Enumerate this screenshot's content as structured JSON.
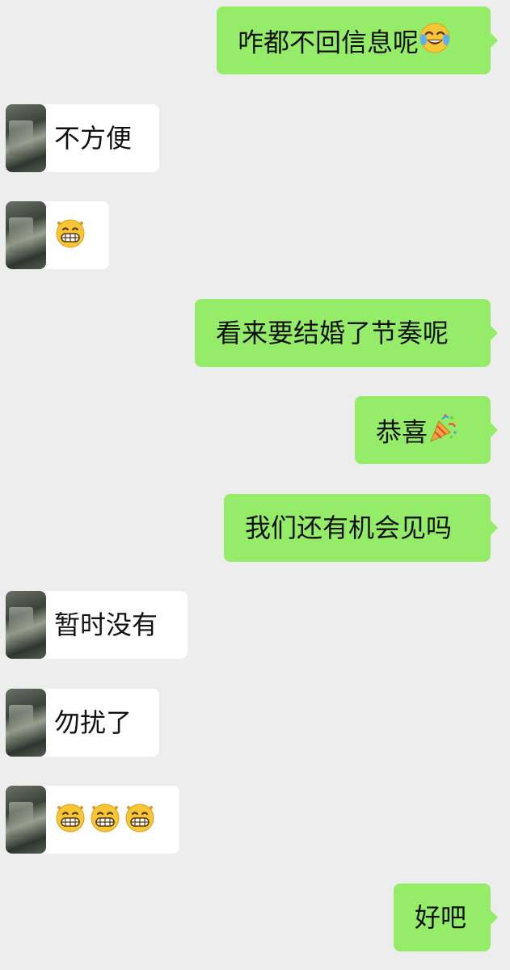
{
  "messages": [
    {
      "side": "sent",
      "text": "咋都不回信息呢",
      "emoji": [
        "tears-of-joy"
      ]
    },
    {
      "side": "recv",
      "text": "不方便",
      "emoji": []
    },
    {
      "side": "recv",
      "text": "",
      "emoji": [
        "grin"
      ]
    },
    {
      "side": "sent",
      "text": "看来要结婚了节奏呢",
      "emoji": []
    },
    {
      "side": "sent",
      "text": "恭喜",
      "emoji": [
        "party-popper"
      ]
    },
    {
      "side": "sent",
      "text": "我们还有机会见吗",
      "emoji": []
    },
    {
      "side": "recv",
      "text": "暂时没有",
      "emoji": []
    },
    {
      "side": "recv",
      "text": "勿扰了",
      "emoji": []
    },
    {
      "side": "recv",
      "text": "",
      "emoji": [
        "grin",
        "grin",
        "grin"
      ]
    },
    {
      "side": "sent",
      "text": "好吧",
      "emoji": []
    }
  ],
  "colors": {
    "background": "#ededed",
    "sent_bubble": "#95ec69",
    "received_bubble": "#ffffff",
    "text": "#111111"
  }
}
